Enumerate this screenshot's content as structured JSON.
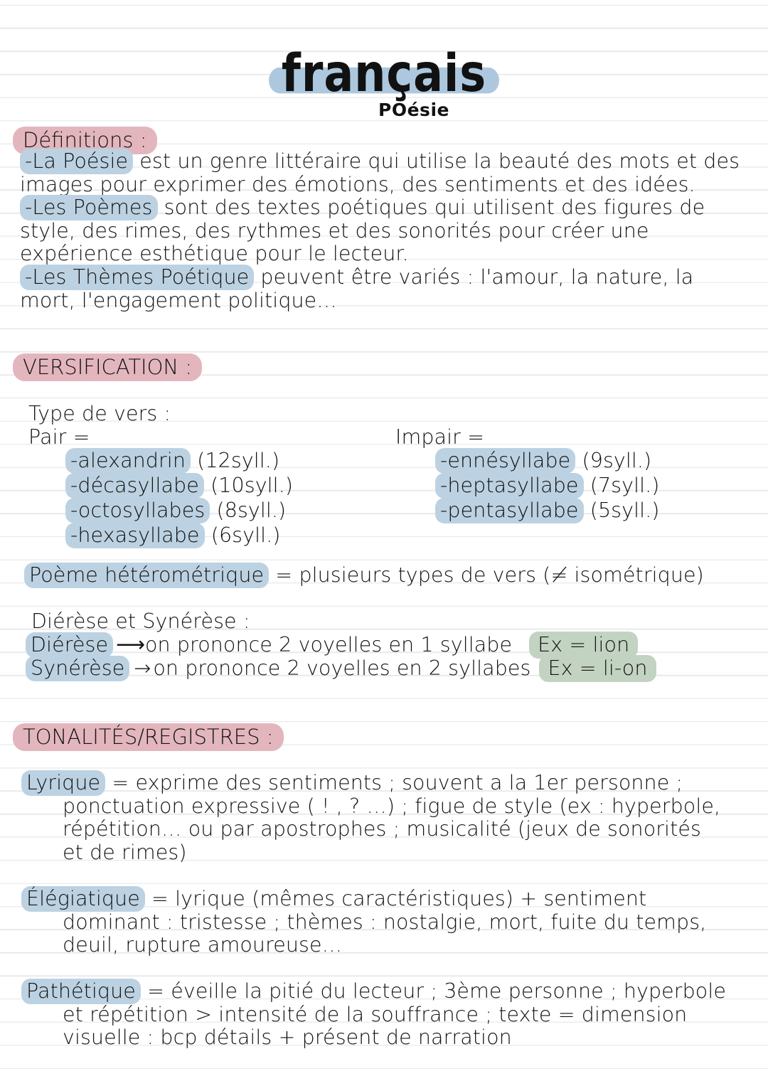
{
  "page": {
    "title": "français",
    "subtitle": "POésie",
    "colors": {
      "highlight_blue": "#bcd2e2",
      "highlight_pink": "#e3b6bd",
      "highlight_green": "#c3d3c2",
      "rule_line": "#e9e9ec",
      "ink": "#121212"
    }
  },
  "definitions": {
    "header": "Définitions :",
    "items": [
      {
        "term": "-La Poésie",
        "body": " est un genre littéraire qui utilise la beauté des mots et des images pour exprimer des émotions, des sentiments et des idées."
      },
      {
        "term": "-Les Poèmes",
        "body": " sont des textes poétiques qui utilisent des figures de style, des rimes, des rythmes et des sonorités pour créer une expérience esthétique pour le lecteur."
      },
      {
        "term": "-Les Thèmes Poétique",
        "body": " peuvent être variés : l'amour, la nature, la mort, l'engagement politique…"
      }
    ]
  },
  "versification": {
    "header": "VERSIFICATION :",
    "type_label": "Type de vers :",
    "pair": {
      "label": "Pair =",
      "items": [
        {
          "name": "-alexandrin",
          "count": "(12syll.)"
        },
        {
          "name": "-décasyllabe",
          "count": "(10syll.)"
        },
        {
          "name": "-octosyllabes",
          "count": "(8syll.)"
        },
        {
          "name": "-hexasyllabe",
          "count": "(6syll.)"
        }
      ]
    },
    "impair": {
      "label": "Impair =",
      "items": [
        {
          "name": "-ennésyllabe",
          "count": "(9syll.)"
        },
        {
          "name": "-heptasyllabe",
          "count": "(7syll.)"
        },
        {
          "name": "-pentasyllabe",
          "count": "(5syll.)"
        }
      ]
    },
    "heterometrique": {
      "term": "Poème hétérométrique",
      "body": " = plusieurs types de vers (≠ isométrique)"
    },
    "dierese_synerese": {
      "label": "Diérèse et Synérèse :",
      "rows": [
        {
          "term": "Diérèse",
          "arrow": "⟶",
          "body": "on prononce 2 voyelles en 1 syllabe",
          "example": "Ex = lion"
        },
        {
          "term": "Synérèse",
          "arrow": "→",
          "body": "on prononce 2 voyelles en 2 syllabes",
          "example": "Ex = li-on"
        }
      ]
    }
  },
  "tonalites": {
    "header": "TONALITÉS/REGISTRES :",
    "entries": [
      {
        "term": "Lyrique",
        "lines": [
          " = exprime des sentiments ; souvent a la 1er personne ;",
          "ponctuation expressive ( ! , ? …) ; figue de style (ex : hyperbole,",
          "répétition… ou par apostrophes ; musicalité (jeux de sonorités",
          "et de rimes)"
        ]
      },
      {
        "term": "Élégiatique",
        "lines": [
          " = lyrique (mêmes caractéristiques) + sentiment",
          "dominant : tristesse ; thèmes : nostalgie, mort, fuite du temps,",
          "deuil, rupture amoureuse…"
        ]
      },
      {
        "term": "Pathétique",
        "lines": [
          " = éveille la pitié du lecteur ; 3ème personne ; hyperbole",
          "et répétition > intensité de la souffrance ; texte = dimension",
          "visuelle : bcp détails + présent de narration"
        ]
      }
    ]
  }
}
